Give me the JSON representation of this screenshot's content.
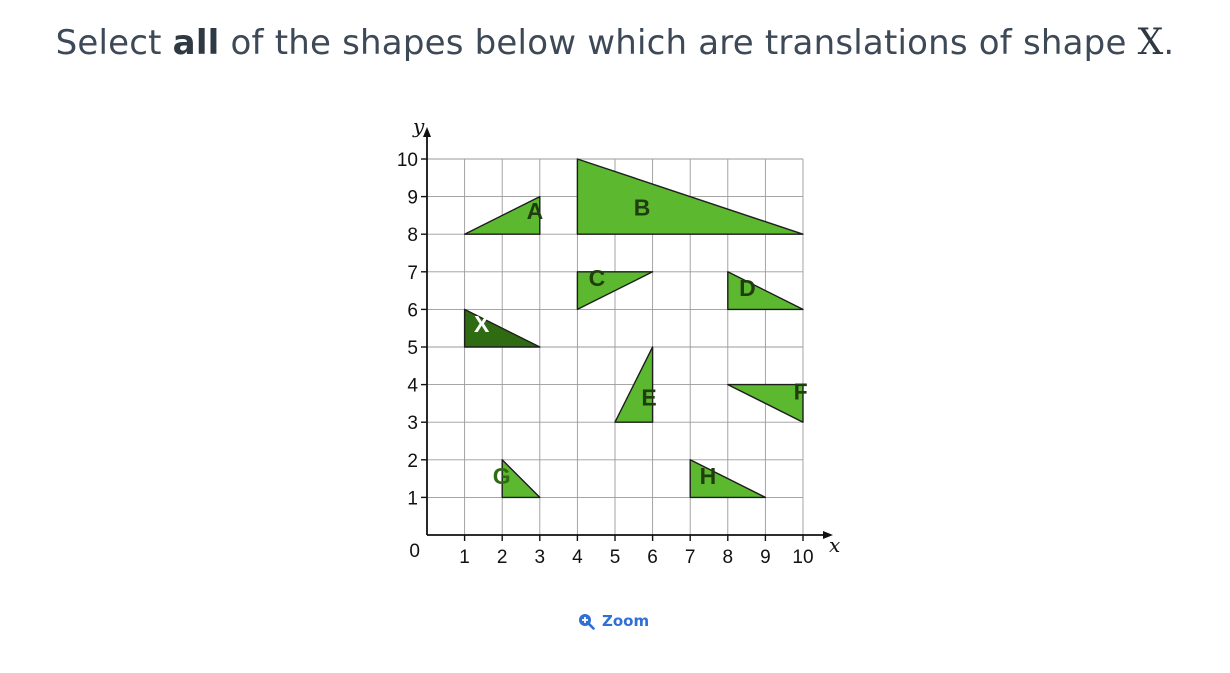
{
  "question": {
    "prefix": "Select ",
    "emphasis": "all",
    "middle": " of the shapes below which are translations of shape ",
    "var": "X",
    "suffix": "."
  },
  "diagram": {
    "xlabel": "x",
    "ylabel": "y",
    "origin_label": "0",
    "x_ticks": [
      1,
      2,
      3,
      4,
      5,
      6,
      7,
      8,
      9,
      10
    ],
    "y_ticks": [
      1,
      2,
      3,
      4,
      5,
      6,
      7,
      8,
      9,
      10
    ],
    "shape_fill": "#5cb82e",
    "shape_x_fill": "#2e6b12",
    "label_dark": "#1f3d0f",
    "label_light": "#ffffff",
    "shapes": [
      {
        "name": "A",
        "vertices": [
          [
            1,
            8
          ],
          [
            3,
            9
          ],
          [
            3,
            8
          ]
        ],
        "label_at": [
          2.65,
          8.4
        ]
      },
      {
        "name": "B",
        "vertices": [
          [
            4,
            10
          ],
          [
            10,
            8
          ],
          [
            4,
            8
          ]
        ],
        "label_at": [
          5.5,
          8.5
        ]
      },
      {
        "name": "C",
        "vertices": [
          [
            4,
            7
          ],
          [
            6,
            7
          ],
          [
            4,
            6
          ]
        ],
        "label_at": [
          4.3,
          6.62
        ]
      },
      {
        "name": "D",
        "vertices": [
          [
            8,
            7
          ],
          [
            10,
            6
          ],
          [
            8,
            6
          ]
        ],
        "label_at": [
          8.3,
          6.35
        ]
      },
      {
        "name": "X",
        "vertices": [
          [
            1,
            6
          ],
          [
            3,
            5
          ],
          [
            1,
            5
          ]
        ],
        "label_at": [
          1.25,
          5.4
        ],
        "highlight": true
      },
      {
        "name": "E",
        "vertices": [
          [
            6,
            5
          ],
          [
            6,
            3
          ],
          [
            5,
            3
          ]
        ],
        "label_at": [
          5.7,
          3.45
        ]
      },
      {
        "name": "F",
        "vertices": [
          [
            8,
            4
          ],
          [
            10,
            4
          ],
          [
            10,
            3
          ]
        ],
        "label_at": [
          9.75,
          3.6
        ]
      },
      {
        "name": "G",
        "vertices": [
          [
            2,
            2
          ],
          [
            3,
            1
          ],
          [
            2,
            1
          ]
        ],
        "label_at": [
          1.75,
          1.35
        ],
        "outside_label": true
      },
      {
        "name": "H",
        "vertices": [
          [
            7,
            2
          ],
          [
            9,
            1
          ],
          [
            7,
            1
          ]
        ],
        "label_at": [
          7.25,
          1.35
        ]
      }
    ]
  },
  "zoom": {
    "label": "Zoom",
    "icon": "zoom-in-icon"
  }
}
